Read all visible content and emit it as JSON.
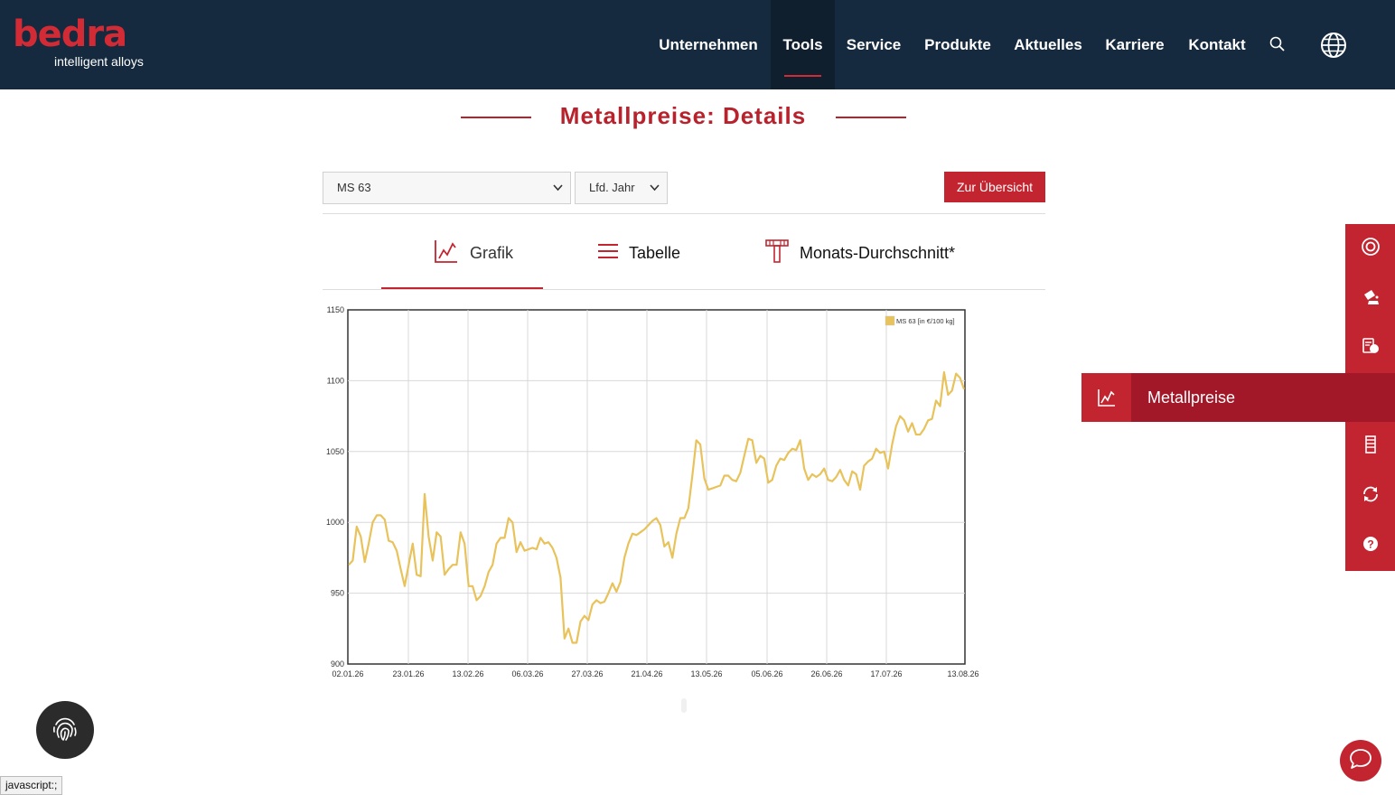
{
  "logo": {
    "main": "bedra",
    "sub": "intelligent alloys"
  },
  "nav": [
    {
      "label": "Unternehmen",
      "active": false
    },
    {
      "label": "Tools",
      "active": true
    },
    {
      "label": "Service",
      "active": false
    },
    {
      "label": "Produkte",
      "active": false
    },
    {
      "label": "Aktuelles",
      "active": false
    },
    {
      "label": "Karriere",
      "active": false
    },
    {
      "label": "Kontakt",
      "active": false
    }
  ],
  "page_title": "Metallpreise: Details",
  "filters": {
    "alloy_selected": "MS 63",
    "period_selected": "Lfd. Jahr"
  },
  "overview_button": "Zur Übersicht",
  "tabs": [
    {
      "label": "Grafik",
      "icon": "line-chart-icon",
      "active": true
    },
    {
      "label": "Tabelle",
      "icon": "list-icon",
      "active": false
    },
    {
      "label": "Monats-Durchschnitt*",
      "icon": "t-bar-icon",
      "active": false
    }
  ],
  "side_menu": {
    "items": [
      "target-icon",
      "pour-icon",
      "coins-icon",
      "line-chart-icon",
      "coil-icon",
      "refresh-icon",
      "help-icon"
    ],
    "flyout_label": "Metallpreise"
  },
  "status_bar": "javascript:;",
  "colors": {
    "brand": "#c2252f",
    "header": "#152a3e",
    "line": "#e8c25a"
  },
  "chart_data": {
    "type": "line",
    "title": "",
    "xlabel": "",
    "ylabel": "",
    "ylim": [
      900,
      1150
    ],
    "yticks": [
      900,
      950,
      1000,
      1050,
      1100,
      1150
    ],
    "xticks": [
      "02.01.26",
      "23.01.26",
      "13.02.26",
      "06.03.26",
      "27.03.26",
      "21.04.26",
      "13.05.26",
      "05.06.26",
      "26.06.26",
      "17.07.26",
      "13.08.26"
    ],
    "legend": {
      "position": "top-right",
      "label": "MS 63 [in €/100 kg]"
    },
    "grid": true,
    "series": [
      {
        "name": "MS 63 [in €/100 kg]",
        "values": [
          970,
          973,
          997,
          990,
          972,
          985,
          1000,
          1005,
          1005,
          1002,
          987,
          986,
          980,
          967,
          955,
          970,
          985,
          963,
          962,
          1020,
          990,
          973,
          993,
          990,
          963,
          967,
          970,
          970,
          993,
          985,
          955,
          955,
          945,
          948,
          955,
          965,
          970,
          985,
          989,
          989,
          1003,
          1000,
          979,
          986,
          980,
          981,
          982,
          981,
          989,
          985,
          986,
          982,
          975,
          961,
          918,
          925,
          915,
          915,
          930,
          934,
          931,
          942,
          945,
          943,
          944,
          950,
          957,
          951,
          958,
          975,
          985,
          992,
          991,
          993,
          995,
          998,
          1001,
          1003,
          998,
          983,
          986,
          975,
          992,
          1003,
          1003,
          1010,
          1033,
          1058,
          1055,
          1031,
          1023,
          1024,
          1025,
          1026,
          1033,
          1033,
          1030,
          1029,
          1035,
          1047,
          1059,
          1058,
          1042,
          1047,
          1045,
          1028,
          1030,
          1040,
          1045,
          1044,
          1049,
          1052,
          1051,
          1058,
          1038,
          1030,
          1034,
          1032,
          1034,
          1038,
          1030,
          1029,
          1032,
          1037,
          1030,
          1026,
          1036,
          1034,
          1023,
          1040,
          1043,
          1045,
          1052,
          1049,
          1050,
          1038,
          1055,
          1068,
          1075,
          1072,
          1064,
          1070,
          1062,
          1062,
          1066,
          1072,
          1073,
          1086,
          1082,
          1106,
          1090,
          1093,
          1105,
          1102,
          1094
        ]
      }
    ]
  }
}
